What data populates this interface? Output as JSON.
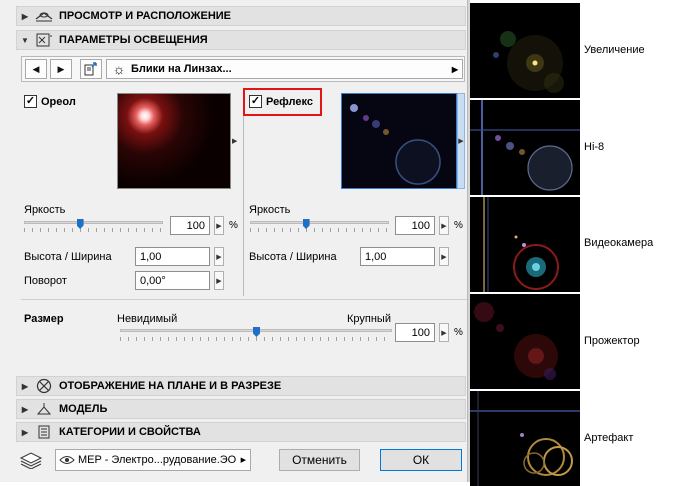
{
  "sections": {
    "view": "ПРОСМОТР И РАСПОЛОЖЕНИЕ",
    "lighting": "ПАРАМЕТРЫ ОСВЕЩЕНИЯ",
    "plan": "ОТОБРАЖЕНИЕ НА ПЛАНЕ И В РАЗРЕЗЕ",
    "model": "МОДЕЛЬ",
    "categories": "КАТЕГОРИИ И СВОЙСТВА"
  },
  "toolbar": {
    "preset": "Блики на Линзах..."
  },
  "halo": {
    "label": "Ореол",
    "checked": true,
    "brightness_label": "Яркость",
    "brightness_value": "100",
    "brightness_level": 0.4,
    "ratio_label": "Высота / Ширина",
    "ratio_value": "1,00",
    "rotation_label": "Поворот",
    "rotation_value": "0,00°"
  },
  "reflex": {
    "label": "Рефлекс",
    "checked": true,
    "brightness_label": "Яркость",
    "brightness_value": "100",
    "brightness_level": 0.4,
    "ratio_label": "Высота / Ширина",
    "ratio_value": "1,00"
  },
  "size": {
    "label": "Размер",
    "min_label": "Невидимый",
    "max_label": "Крупный",
    "value": "100",
    "level": 0.5
  },
  "percent": "%",
  "footer": {
    "layer": "MEP - Электро...рудование.ЭО",
    "cancel": "Отменить",
    "ok": "ОК"
  },
  "thumbnails": [
    {
      "label": "Увеличение"
    },
    {
      "label": "Hi-8"
    },
    {
      "label": "Видеокамера"
    },
    {
      "label": "Прожектор"
    },
    {
      "label": "Артефакт"
    }
  ],
  "colors": {
    "highlight": "#e21414",
    "slider": "#1e70c8"
  }
}
